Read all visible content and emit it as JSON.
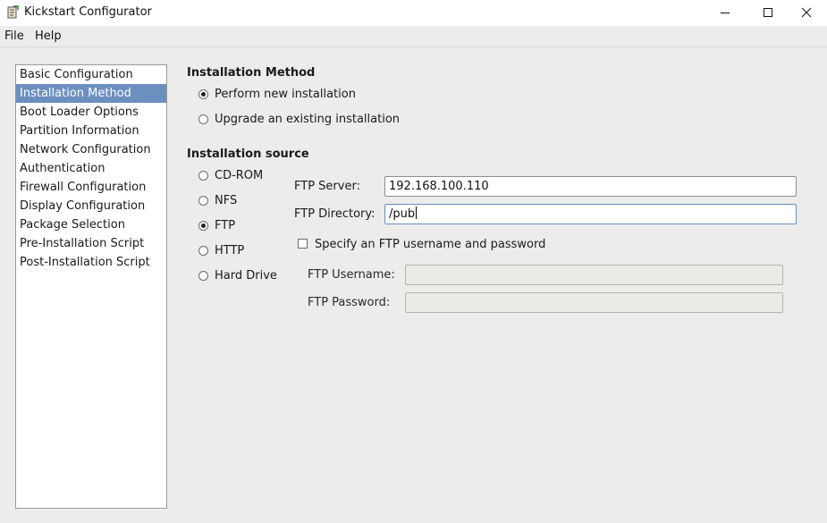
{
  "window": {
    "title": "Kickstart Configurator"
  },
  "menu": [
    "File",
    "Help"
  ],
  "sidebar": {
    "items": [
      "Basic Configuration",
      "Installation Method",
      "Boot Loader Options",
      "Partition Information",
      "Network Configuration",
      "Authentication",
      "Firewall Configuration",
      "Display Configuration",
      "Package Selection",
      "Pre-Installation Script",
      "Post-Installation Script"
    ],
    "selected": "Installation Method"
  },
  "method": {
    "title": "Installation Method",
    "options": [
      "Perform new installation",
      "Upgrade an existing installation"
    ],
    "selected": "Perform new installation"
  },
  "source": {
    "title": "Installation source",
    "options": [
      "CD-ROM",
      "NFS",
      "FTP",
      "HTTP",
      "Hard Drive"
    ],
    "selected": "FTP"
  },
  "ftp": {
    "server_label": "FTP Server:",
    "server_value": "192.168.100.110",
    "directory_label": "FTP Directory:",
    "directory_value": "/pub",
    "auth_checkbox_label": "Specify an FTP username and password",
    "auth_checked": false,
    "username_label": "FTP Username:",
    "username_value": "",
    "password_label": "FTP Password:",
    "password_value": ""
  }
}
